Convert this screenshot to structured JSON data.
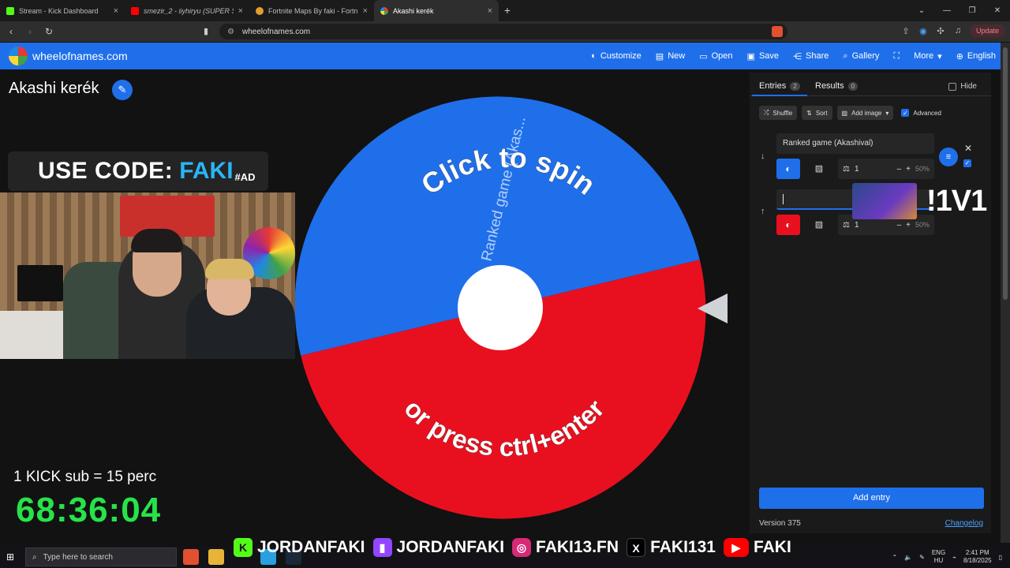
{
  "browser": {
    "tabs": [
      {
        "title": "Stream - Kick Dashboard",
        "icon": "kick-icon",
        "color": "#53fc18",
        "active": false
      },
      {
        "title": "smezir_2 - iiyhiryu (SUPER S...",
        "icon": "youtube-icon",
        "color": "#ff0000",
        "active": false
      },
      {
        "title": "Fortnite Maps By faki - Fortnite.GG",
        "icon": "fortnite-gg-icon",
        "color": "#e0a030",
        "active": false
      },
      {
        "title": "Akashi kerék",
        "icon": "wheel-icon",
        "color": "#1f6fea",
        "active": true
      }
    ],
    "url": "wheelofnames.com",
    "update_label": "Update"
  },
  "header": {
    "site_name": "wheelofnames.com",
    "menu": [
      {
        "label": "Customize",
        "icon": "palette-icon",
        "glyph": "🎨"
      },
      {
        "label": "New",
        "icon": "file-icon",
        "glyph": "▤"
      },
      {
        "label": "Open",
        "icon": "folder-icon",
        "glyph": "▭"
      },
      {
        "label": "Save",
        "icon": "save-icon",
        "glyph": "▣"
      },
      {
        "label": "Share",
        "icon": "share-icon",
        "glyph": "⋲"
      },
      {
        "label": "Gallery",
        "icon": "search-icon",
        "glyph": "⌕"
      },
      {
        "label": "",
        "icon": "fullscreen-icon",
        "glyph": "⛶"
      },
      {
        "label": "More",
        "icon": "chevron-down-icon",
        "glyph": "▾"
      },
      {
        "label": "English",
        "icon": "globe-icon",
        "glyph": "⊕"
      }
    ]
  },
  "main": {
    "wheel_title": "Akashi kerék",
    "wheel": {
      "segments": [
        {
          "label": "Ranked game (Akas...",
          "color": "#1f6fea"
        },
        {
          "label": "",
          "color": "#e8101f"
        }
      ],
      "prompt_top": "Click to spin",
      "prompt_bottom": "or press ctrl+enter"
    }
  },
  "overlay": {
    "promo_a": "USE CODE:",
    "promo_b": "FAKI",
    "promo_c": "#AD",
    "kick_line": "1 KICK sub = 15 perc",
    "timer": "68:36:04",
    "tag_1v1": "!1V1"
  },
  "panel": {
    "tabs": [
      {
        "label": "Entries",
        "count": "2"
      },
      {
        "label": "Results",
        "count": "0"
      }
    ],
    "hide_label": "Hide",
    "tools": [
      {
        "label": "Shuffle",
        "icon": "shuffle-icon",
        "glyph": "⤮"
      },
      {
        "label": "Sort",
        "icon": "sort-icon",
        "glyph": "⇅"
      },
      {
        "label": "Add image",
        "icon": "image-icon",
        "glyph": "▨"
      }
    ],
    "advanced_label": "Advanced",
    "entries": [
      {
        "text": "Ranked game (Akashival)",
        "color": "#1f6fea",
        "weight": "1",
        "percent": "50%"
      },
      {
        "text": "",
        "color": "#e8101f",
        "weight": "1",
        "percent": "50%"
      }
    ],
    "add_entry_label": "Add entry",
    "version": "Version 375",
    "changelog": "Changelog"
  },
  "socials": [
    {
      "handle": "JORDANFAKI",
      "icon": "kick-icon",
      "color": "#53fc18",
      "glyph": "K"
    },
    {
      "handle": "JORDANFAKI",
      "icon": "twitch-icon",
      "color": "#9146ff",
      "glyph": "▮"
    },
    {
      "handle": "FAKI13.FN",
      "icon": "instagram-icon",
      "color": "#d62976",
      "glyph": "◎"
    },
    {
      "handle": "FAKI131",
      "icon": "x-icon",
      "color": "#000000",
      "glyph": "X"
    },
    {
      "handle": "FAKI",
      "icon": "youtube-icon",
      "color": "#ff0000",
      "glyph": "▶"
    }
  ],
  "taskbar": {
    "search_placeholder": "Type here to search",
    "lang_1": "ENG",
    "lang_2": "HU",
    "time": "2:41 PM",
    "date": "8/18/2025"
  }
}
